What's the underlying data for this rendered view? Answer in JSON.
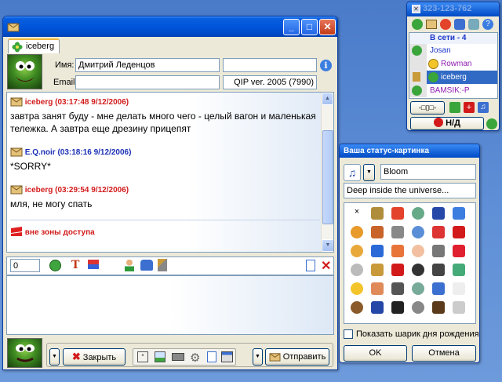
{
  "chat": {
    "tab_label": "iceberg",
    "name_label": "Имя:",
    "name_value": "Дмитрий Леденцов",
    "email_label": "Email:",
    "client_value": "QIP ver. 2005 (7990)",
    "messages": [
      {
        "header": "iceberg (03:17:48 9/12/2006)",
        "text": "завтра занят буду - мне делать много чего - целый вагон и маленькая тележка. А завтра еще дрезину прицепят"
      },
      {
        "header": "E.Q.noir (03:18:16 9/12/2006)",
        "text": "*SORRY*"
      },
      {
        "header": "iceberg (03:29:54 9/12/2006)",
        "text": "мля, не могу спать"
      },
      {
        "header": "вне зоны доступа",
        "text": ""
      }
    ],
    "counter": "0",
    "close_label": "Закрыть",
    "send_label": "Отправить"
  },
  "contacts": {
    "uin": "323-123-762",
    "group_label": "В сети - 4",
    "items": [
      "Josan",
      "Rowman",
      "iceberg",
      "BAMSIK:-P"
    ],
    "status_button": "Н/Д"
  },
  "status_pic": {
    "title": "Ваша статус-картинка",
    "status_name": "Bloom",
    "status_text": "Deep inside the universe...",
    "birthday_label": "Показать шарик дня рождения",
    "ok_label": "OK",
    "cancel_label": "Отмена",
    "icons": [
      "close",
      "hourglass",
      "bag",
      "cart",
      "a",
      "help",
      "sleepy",
      "burger",
      "binoculars",
      "pencil",
      "rocket",
      "flag",
      "face",
      "tv",
      "angry",
      "cake",
      "gamepad",
      "heart",
      "ghost",
      "cup",
      "phone",
      "wizard",
      "mobile",
      "people",
      "star",
      "cocktail",
      "anchor",
      "mouse",
      "drink",
      "sheep",
      "mug",
      "music",
      "grad",
      "smoke",
      "pen",
      "book"
    ]
  }
}
